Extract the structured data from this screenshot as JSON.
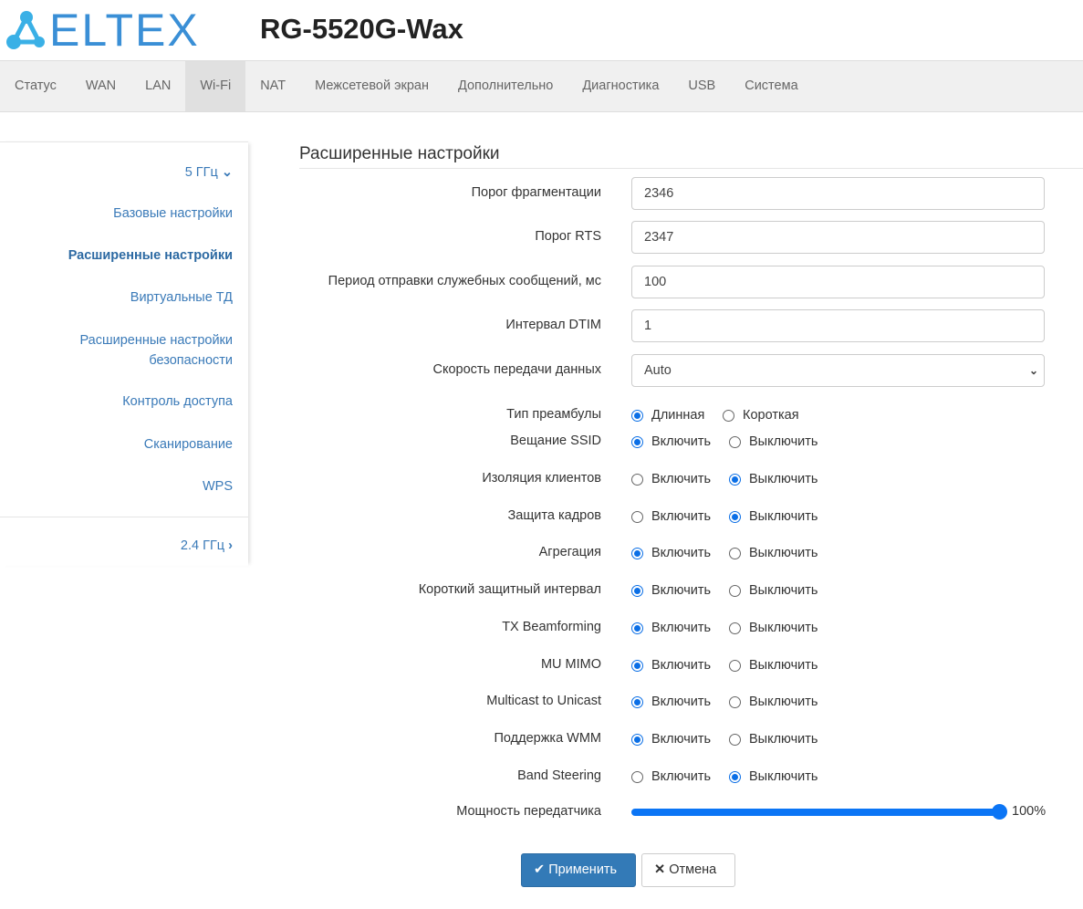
{
  "header": {
    "logo": "ELTEX",
    "model": "RG-5520G-Wax"
  },
  "nav": [
    "Статус",
    "WAN",
    "LAN",
    "Wi-Fi",
    "NAT",
    "Межсетевой экран",
    "Дополнительно",
    "Диагностика",
    "USB",
    "Система"
  ],
  "nav_active": 3,
  "sidebar": {
    "band5": "5 ГГц",
    "items": [
      "Базовые настройки",
      "Расширенные настройки",
      "Виртуальные ТД",
      "Расширенные настройки",
      "безопасности",
      "Контроль доступа",
      "Сканирование",
      "WPS"
    ],
    "band24": "2.4 ГГц"
  },
  "heading": "Расширенные настройки",
  "inputs": [
    {
      "label": "Порог фрагментации",
      "value": "2346"
    },
    {
      "label": "Порог RTS",
      "value": "2347"
    },
    {
      "label": "Период отправки служебных сообщений, мс",
      "value": "100"
    },
    {
      "label": "Интервал DTIM",
      "value": "1"
    },
    {
      "label": "Скорость передачи данных",
      "value": "Auto",
      "select": true
    }
  ],
  "radios": [
    {
      "label": "Тип преамбулы",
      "options": [
        "Длинная",
        "Короткая"
      ],
      "selected": 0
    },
    {
      "label": "Вещание SSID",
      "options": [
        "Включить",
        "Выключить"
      ],
      "selected": 0
    },
    {
      "label": "Изоляция клиентов",
      "options": [
        "Включить",
        "Выключить"
      ],
      "selected": 1
    },
    {
      "label": "Защита кадров",
      "options": [
        "Включить",
        "Выключить"
      ],
      "selected": 1
    },
    {
      "label": "Агрегация",
      "options": [
        "Включить",
        "Выключить"
      ],
      "selected": 0
    },
    {
      "label": "Короткий защитный интервал",
      "options": [
        "Включить",
        "Выключить"
      ],
      "selected": 0
    },
    {
      "label": "TX Beamforming",
      "options": [
        "Включить",
        "Выключить"
      ],
      "selected": 0
    },
    {
      "label": "MU MIMO",
      "options": [
        "Включить",
        "Выключить"
      ],
      "selected": 0
    },
    {
      "label": "Multicast to Unicast",
      "options": [
        "Включить",
        "Выключить"
      ],
      "selected": 0
    },
    {
      "label": "Поддержка WMM",
      "options": [
        "Включить",
        "Выключить"
      ],
      "selected": 0
    },
    {
      "label": "Band Steering",
      "options": [
        "Включить",
        "Выключить"
      ],
      "selected": 1
    }
  ],
  "power": {
    "label": "Мощность передатчика",
    "value": 100,
    "text": "100%"
  },
  "buttons": {
    "apply": "Применить",
    "cancel": "Отмена"
  },
  "colors": {
    "accent": "#337ab7",
    "radio": "#0b6fe6"
  }
}
